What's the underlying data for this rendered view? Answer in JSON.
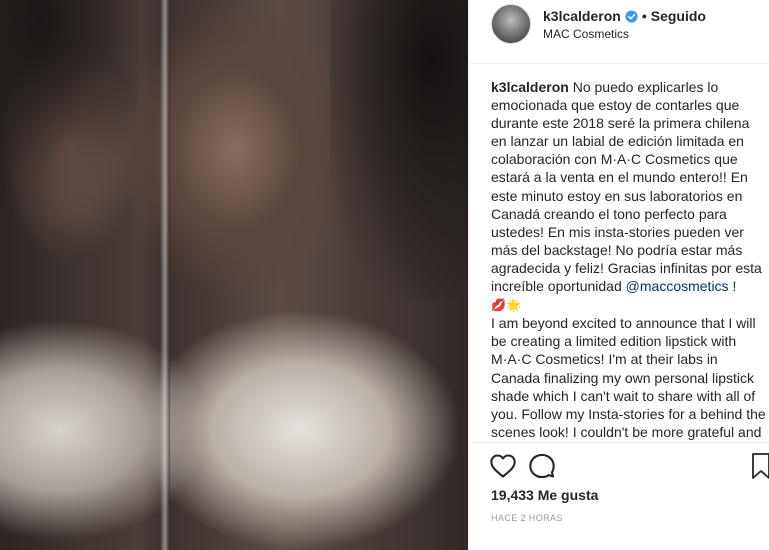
{
  "post": {
    "image_alt": "Photo of woman with dark hair and sheer lace top, photographed as a folded magazine page"
  },
  "header": {
    "username": "k3lcalderon",
    "verified_icon": "verified-badge-icon",
    "separator": "•",
    "follow_state": "Seguido",
    "location": "MAC Cosmetics"
  },
  "caption": {
    "username": "k3lcalderon",
    "text_es_1": "No puedo explicarles lo emocionada que estoy de contarles que durante este 2018 seré la primera chilena en lanzar un labial de edición limitada en colaboración con M·A·C Cosmetics que estará a la venta en el mundo entero!! En este minuto estoy en sus laboratorios en Canadá creando el tono perfecto para ustedes! En mis insta-stories pueden ver más del backstage! No podría estar más agradecida y feliz! Gracias infinitas por esta increíble oportunidad",
    "mention": "@maccosmetics",
    "text_es_2": "!",
    "emojis": "💋🌟",
    "text_en": "I am beyond excited to announce that I will be creating a limited edition lipstick with M·A·C Cosmetics! I'm at their labs in Canada finalizing my own personal lipstick shade which I can't wait to share with all of you. Follow my Insta-stories for a behind the scenes look! I couldn't be more grateful and happy! Thank you"
  },
  "actions": {
    "like_icon": "heart-icon",
    "comment_icon": "comment-bubble-icon",
    "save_icon": "bookmark-icon"
  },
  "likes": "19,433 Me gusta",
  "timestamp": "HACE 2 HORAS",
  "colors": {
    "text": "#262626",
    "mention": "#003569",
    "verified": "#3897f0",
    "muted": "#999999",
    "border": "#efefef"
  }
}
